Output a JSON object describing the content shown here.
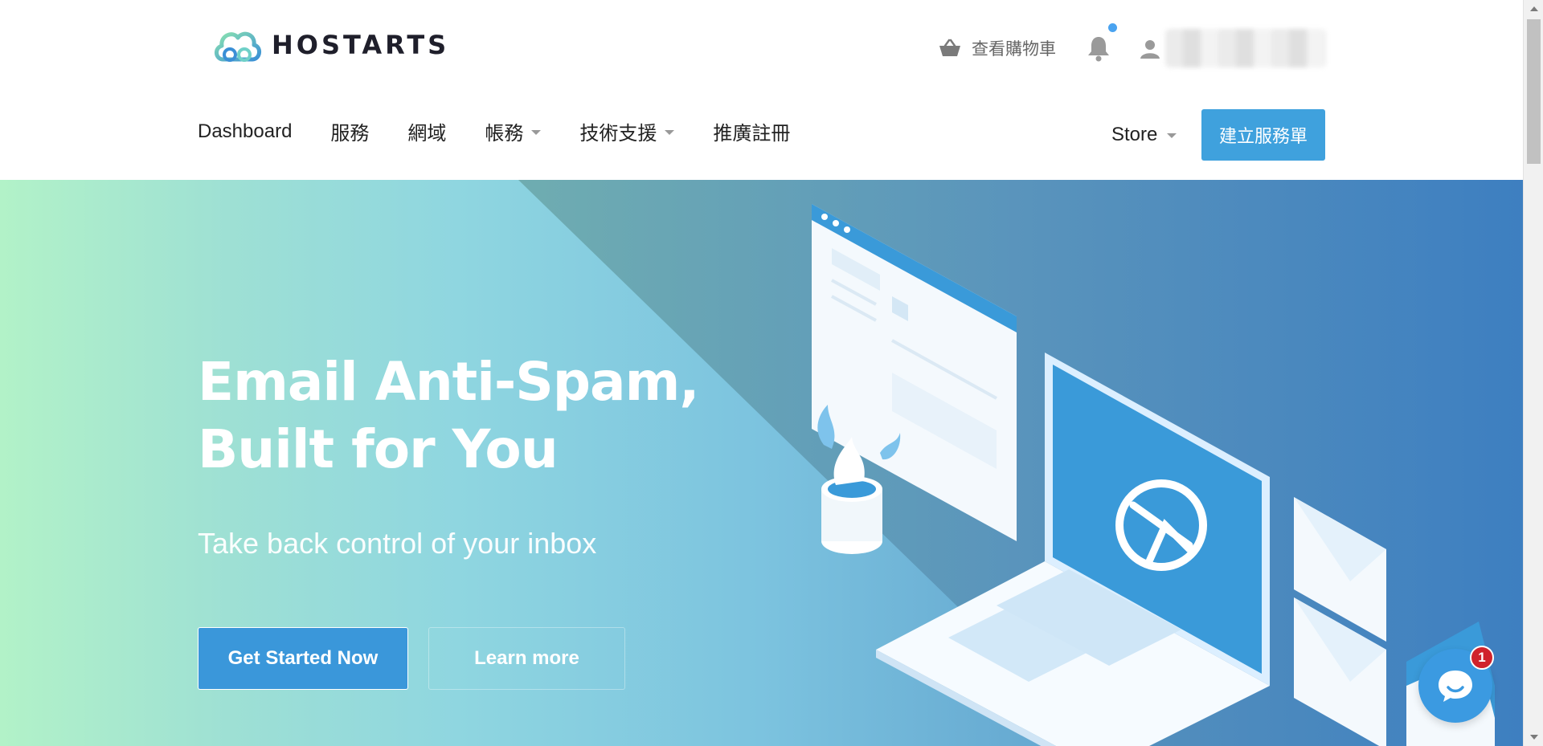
{
  "brand": {
    "name": "HOSTARTS"
  },
  "header": {
    "cart_label": "查看購物車",
    "notification_indicator": true
  },
  "nav": {
    "items": [
      {
        "label": "Dashboard",
        "dropdown": false
      },
      {
        "label": "服務",
        "dropdown": false
      },
      {
        "label": "網域",
        "dropdown": false
      },
      {
        "label": "帳務",
        "dropdown": true
      },
      {
        "label": "技術支援",
        "dropdown": true
      },
      {
        "label": "推廣註冊",
        "dropdown": false
      }
    ],
    "store_label": "Store",
    "ticket_button": "建立服務單"
  },
  "hero": {
    "title": "Email Anti-Spam, Built for You",
    "subtitle": "Take back control of your inbox",
    "primary_button": "Get Started Now",
    "secondary_button": "Learn more"
  },
  "chat": {
    "badge_count": "1"
  },
  "colors": {
    "accent": "#3fa1dd",
    "hero_start": "#b2f2c8",
    "hero_end": "#3f84c4",
    "badge": "#d0222b"
  }
}
